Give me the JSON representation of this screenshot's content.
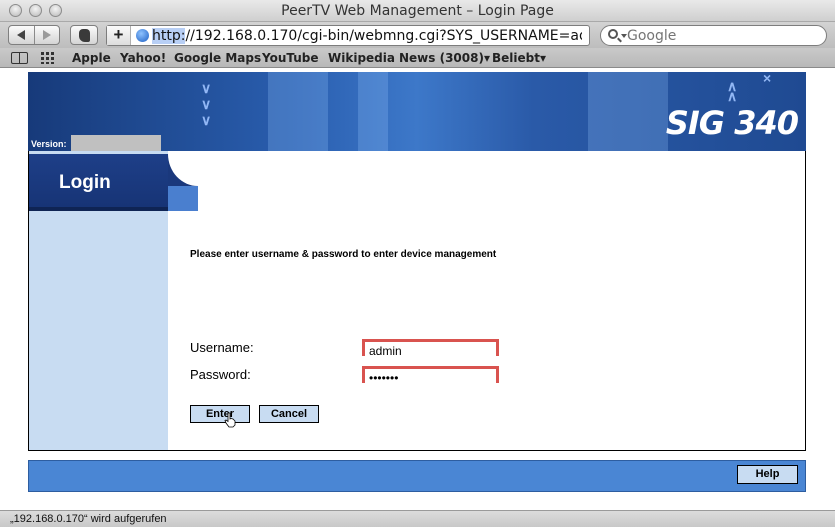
{
  "window": {
    "title": "PeerTV Web Management – Login Page"
  },
  "toolbar": {
    "url_scheme": "http:",
    "url_rest": "//192.168.0.170/cgi-bin/webmng.cgi?SYS_USERNAME=admin&S",
    "search_placeholder": "Google"
  },
  "bookmarks": [
    "Apple",
    "Yahoo!",
    "Google Maps",
    "YouTube",
    "Wikipedia",
    "News (3008)▾",
    "Beliebt▾"
  ],
  "banner": {
    "brand": "SIG 340",
    "version_label": "Version:"
  },
  "sidebar": {
    "login_label": "Login"
  },
  "form": {
    "instruction": "Please enter username & password to enter device management",
    "username_label": "Username:",
    "username_value": "admin",
    "password_label": "Password:",
    "password_value": "1234567",
    "enter_label": "Enter",
    "cancel_label": "Cancel"
  },
  "footer": {
    "help_label": "Help"
  },
  "status": {
    "text": "„192.168.0.170“ wird aufgerufen"
  }
}
